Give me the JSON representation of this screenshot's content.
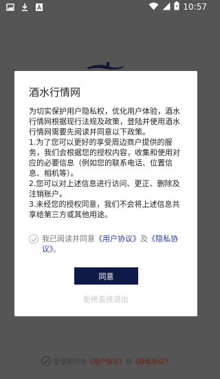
{
  "status_bar": {
    "time": "10:57",
    "left_icons": [
      "image-icon",
      "download-icon",
      "text-a-icon"
    ],
    "right_icons": [
      "wifi-icon",
      "signal-icon",
      "battery-icon"
    ]
  },
  "dialog": {
    "title": "酒水行情网",
    "intro": "为切实保护用户隐私权，优化用户体验，酒水行情网根据现行法规及政策，登陆并使用酒水行情网需要先阅读并同意以下政策。",
    "item1": " 1.为了您可以更好的享受周边商户提供的服务，我们会根据您的授权内容，收集和使用对应的必要信息（例如您的联系电话、位置信息、相机等）。",
    "item2": " 2.您可以对上述信息进行访问、更正、删除及 注销账户。",
    "item3": " 3.未经您的授权同意，我们不会将上述信息共享给第三方或其他用途。",
    "consent_prefix": "我已阅读并同意",
    "consent_user_agreement": "《用户协议》",
    "consent_and": "及",
    "consent_privacy_agreement": "《隐私协议》",
    "consent_suffix": "。",
    "agree_label": "同意",
    "exit_label": "拒绝直接退出"
  },
  "bottom": {
    "prefix": "登录即同意",
    "user_agreement": "《用户协议》",
    "and": "和",
    "privacy_agreement": "《隐私协议》"
  },
  "colors": {
    "overlay": "#555555",
    "button": "#101a48",
    "link": "#243a8f",
    "bottom_link": "#6b1a10"
  }
}
